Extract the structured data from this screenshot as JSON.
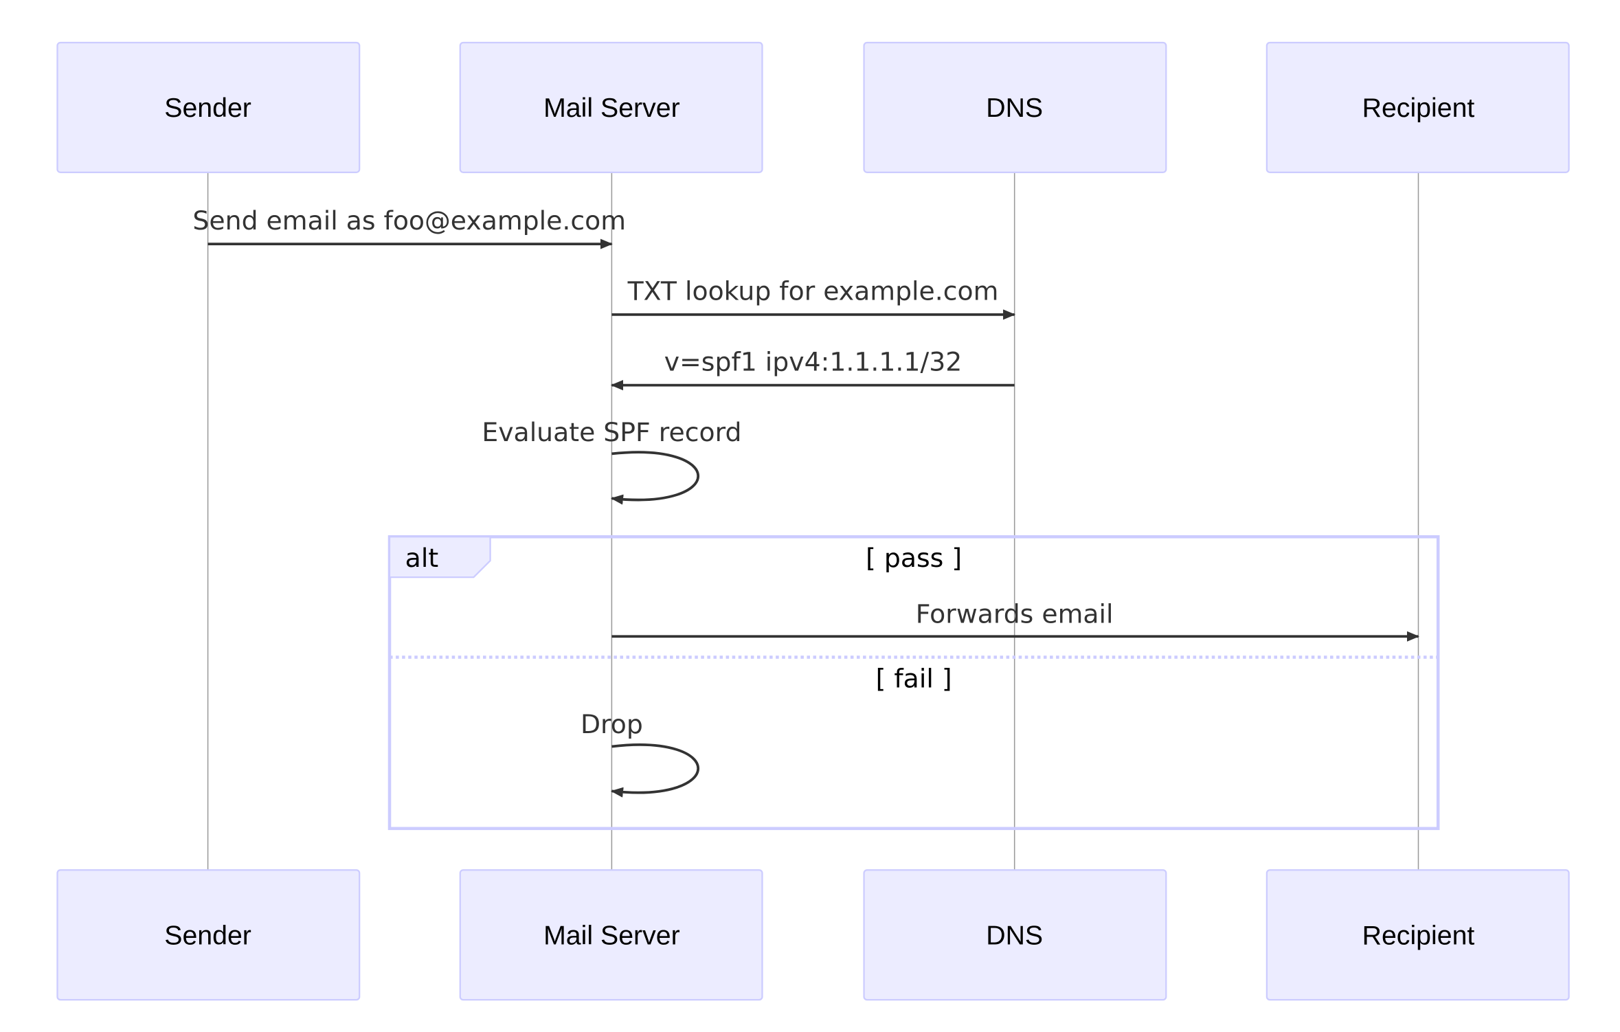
{
  "participants": [
    "Sender",
    "Mail Server",
    "DNS",
    "Recipient"
  ],
  "messages": [
    {
      "from": "Sender",
      "to": "Mail Server",
      "label": "Send email as foo@example.com"
    },
    {
      "from": "Mail Server",
      "to": "DNS",
      "label": "TXT lookup for example.com"
    },
    {
      "from": "DNS",
      "to": "Mail Server",
      "label": "v=spf1 ipv4:1.1.1.1/32"
    },
    {
      "from": "Mail Server",
      "to": "Mail Server",
      "label": "Evaluate SPF record"
    }
  ],
  "alt": {
    "keyword": "alt",
    "branches": [
      {
        "condition": "[ pass ]",
        "messages": [
          {
            "from": "Mail Server",
            "to": "Recipient",
            "label": "Forwards email"
          }
        ]
      },
      {
        "condition": "[ fail ]",
        "messages": [
          {
            "from": "Mail Server",
            "to": "Mail Server",
            "label": "Drop"
          }
        ]
      }
    ]
  },
  "colors": {
    "actor_fill": "#ECECFF",
    "actor_border": "#CCCCFF",
    "line": "#333333",
    "lifeline": "#999999"
  }
}
